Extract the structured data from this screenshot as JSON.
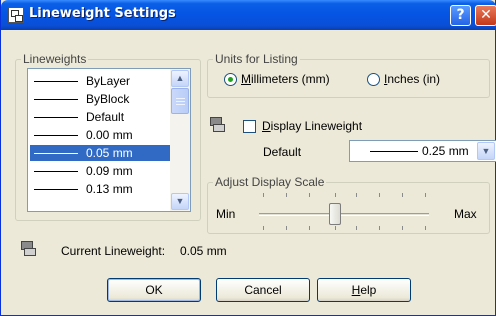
{
  "window": {
    "title": "Lineweight Settings",
    "help_glyph": "?",
    "close_glyph": "✕"
  },
  "lineweights": {
    "legend": "Lineweights",
    "items": [
      {
        "label": "ByLayer"
      },
      {
        "label": "ByBlock"
      },
      {
        "label": "Default"
      },
      {
        "label": "0.00 mm"
      },
      {
        "label": "0.05 mm"
      },
      {
        "label": "0.09 mm"
      },
      {
        "label": "0.13 mm"
      }
    ],
    "selected_label": "0.05 mm"
  },
  "units": {
    "legend": "Units for Listing",
    "mm_mnemonic": "M",
    "mm_rest": "illimeters (mm)",
    "in_mnemonic": "I",
    "in_rest": "nches (in)",
    "selected": "Millimeters (mm)"
  },
  "display": {
    "checkbox_mnemonic": "D",
    "checkbox_rest": "isplay Lineweight",
    "checked": false,
    "default_label": "Default",
    "default_value": "0.25 mm"
  },
  "scale": {
    "legend": "Adjust Display Scale",
    "min_label": "Min",
    "max_label": "Max",
    "level": 0.45
  },
  "current": {
    "label": "Current Lineweight:",
    "value": "0.05 mm"
  },
  "buttons": {
    "ok": "OK",
    "cancel": "Cancel",
    "help_mnemonic": "H",
    "help_rest": "elp"
  },
  "colors": {
    "accent": "#0554e3",
    "selection": "#316ac5",
    "dialog_bg": "#ece9d8"
  },
  "icons": {
    "scroll_up": "▲",
    "scroll_down": "▼",
    "combo_drop": "▼"
  }
}
